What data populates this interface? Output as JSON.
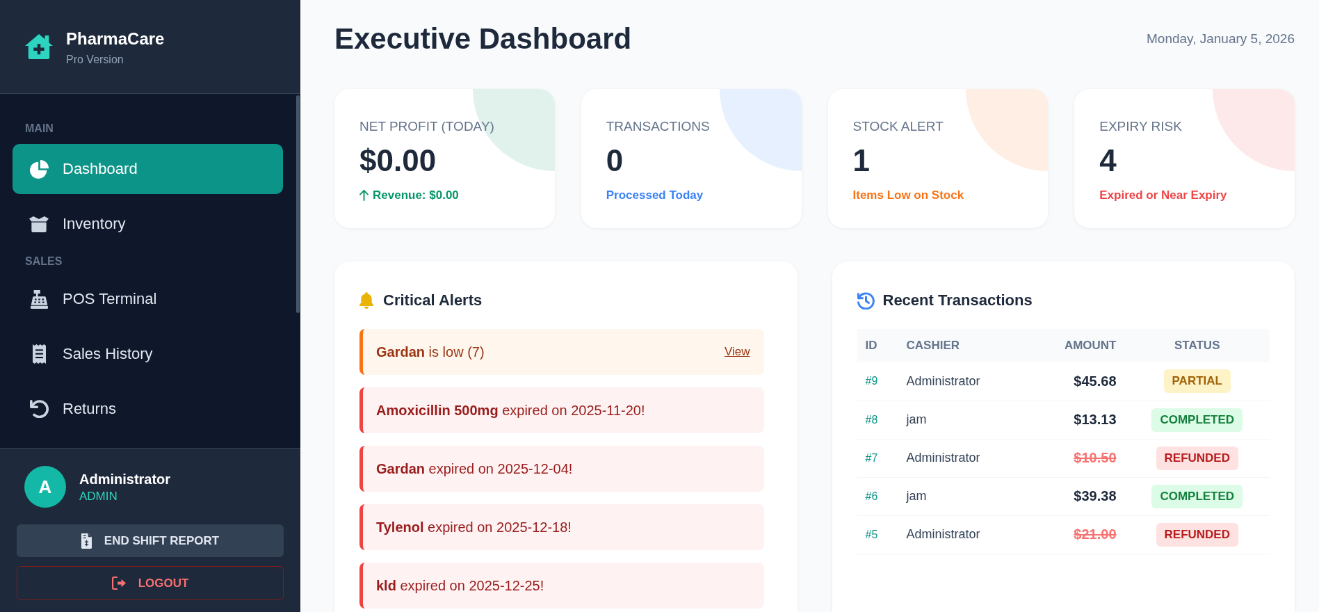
{
  "sidebar": {
    "brand": {
      "name": "PharmaCare",
      "subtitle": "Pro Version"
    },
    "sections": [
      {
        "label": "MAIN",
        "items": [
          {
            "label": "Dashboard",
            "selected": true
          },
          {
            "label": "Inventory",
            "selected": false
          }
        ]
      },
      {
        "label": "SALES",
        "items": [
          {
            "label": "POS Terminal",
            "selected": false
          },
          {
            "label": "Sales History",
            "selected": false
          },
          {
            "label": "Returns",
            "selected": false
          }
        ]
      }
    ],
    "user": {
      "initial": "A",
      "name": "Administrator",
      "role": "ADMIN"
    },
    "buttons": [
      {
        "label": "END SHIFT REPORT",
        "kind": "report"
      },
      {
        "label": "LOGOUT",
        "kind": "logout"
      }
    ]
  },
  "header": {
    "title": "Executive Dashboard",
    "date": "Monday, January 5, 2026"
  },
  "stats": [
    {
      "label": "NET PROFIT (TODAY)",
      "value": "$0.00",
      "note": "Revenue: $0.00",
      "rising": true,
      "color": "#059669"
    },
    {
      "label": "TRANSACTIONS",
      "value": "0",
      "note": "Processed Today",
      "rising": false,
      "color": "#3b82f6"
    },
    {
      "label": "STOCK ALERT",
      "value": "1",
      "note": "Items Low on Stock",
      "rising": false,
      "color": "#f97316"
    },
    {
      "label": "EXPIRY RISK",
      "value": "4",
      "note": "Expired or Near Expiry",
      "rising": false,
      "color": "#ef4444"
    }
  ],
  "alerts": {
    "title": "Critical Alerts",
    "items": [
      {
        "kind": "low_stock",
        "text": "**Gardan** is low (7)",
        "link": "View"
      },
      {
        "kind": "expired",
        "text": "**Amoxicillin 500mg** expired on 2025-11-20!"
      },
      {
        "kind": "expired",
        "text": "**Gardan** expired on 2025-12-04!"
      },
      {
        "kind": "expired",
        "text": "**Tylenol** expired on 2025-12-18!"
      },
      {
        "kind": "expired",
        "text": "**kld** expired on 2025-12-25!"
      }
    ]
  },
  "transactions": {
    "title": "Recent Transactions",
    "columns": [
      "ID",
      "CASHIER",
      "AMOUNT",
      "STATUS"
    ],
    "rows": [
      {
        "id": "#9",
        "cashier": "Administrator",
        "amount": "$45.68",
        "struck": false,
        "status": "PARTIAL",
        "kind": "partial"
      },
      {
        "id": "#8",
        "cashier": "jam",
        "amount": "$13.13",
        "struck": false,
        "status": "COMPLETED",
        "kind": "completed"
      },
      {
        "id": "#7",
        "cashier": "Administrator",
        "amount": "$10.50",
        "struck": true,
        "status": "REFUNDED",
        "kind": "refunded"
      },
      {
        "id": "#6",
        "cashier": "jam",
        "amount": "$39.38",
        "struck": false,
        "status": "COMPLETED",
        "kind": "completed"
      },
      {
        "id": "#5",
        "cashier": "Administrator",
        "amount": "$21.00",
        "struck": true,
        "status": "REFUNDED",
        "kind": "refunded"
      }
    ]
  }
}
